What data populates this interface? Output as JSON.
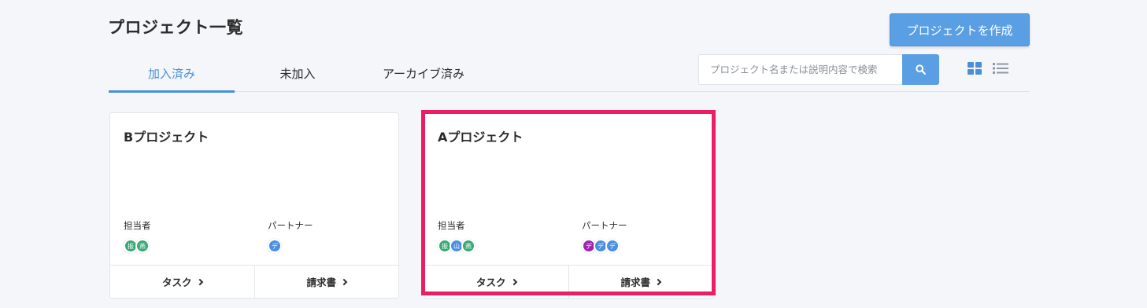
{
  "page": {
    "title": "プロジェクト一覧",
    "create_button": "プロジェクトを作成"
  },
  "tabs": [
    {
      "label": "加入済み",
      "active": true
    },
    {
      "label": "未加入",
      "active": false
    },
    {
      "label": "アーカイブ済み",
      "active": false
    }
  ],
  "search": {
    "placeholder": "プロジェクト名または説明内容で検索",
    "value": ""
  },
  "view_toggle": {
    "grid_icon": "grid-view-icon",
    "list_icon": "list-view-icon"
  },
  "projects": [
    {
      "name": "Bプロジェクト",
      "staff_label": "担当者",
      "partner_label": "パートナー",
      "staff": [
        {
          "initial": "振",
          "color": "#3aa876"
        },
        {
          "initial": "燕",
          "color": "#3aa876"
        }
      ],
      "partners": [
        {
          "initial": "デ",
          "color": "#4a8fe0"
        }
      ],
      "task_label": "タスク",
      "invoice_label": "請求書"
    },
    {
      "name": "Aプロジェクト",
      "staff_label": "担当者",
      "partner_label": "パートナー",
      "staff": [
        {
          "initial": "振",
          "color": "#3aa876"
        },
        {
          "initial": "山",
          "color": "#4a8fe0"
        },
        {
          "initial": "燕",
          "color": "#3aa876"
        }
      ],
      "partners": [
        {
          "initial": "デ",
          "color": "#9b27af"
        },
        {
          "initial": "デ",
          "color": "#4a8fe0"
        },
        {
          "initial": "デ",
          "color": "#4a8fe0"
        }
      ],
      "task_label": "タスク",
      "invoice_label": "請求書"
    }
  ],
  "colors": {
    "accent": "#4a8fd8",
    "button": "#5a9ee3",
    "highlight": "#e91e63",
    "background": "#f5f6fa"
  }
}
